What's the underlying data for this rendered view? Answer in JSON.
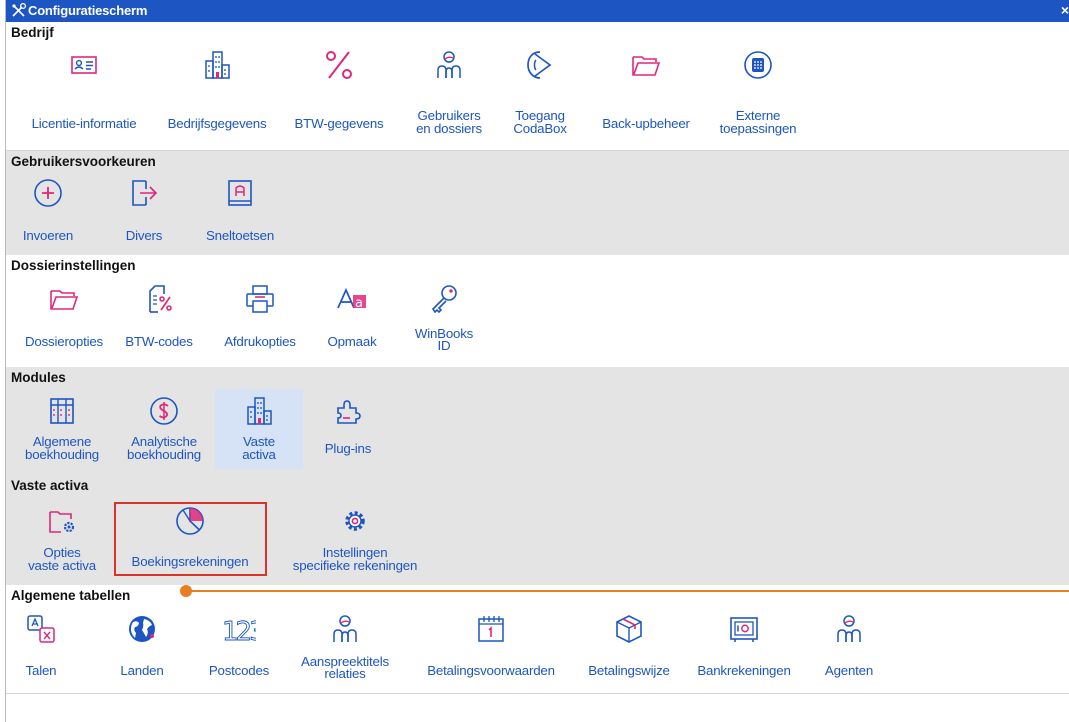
{
  "window": {
    "title": "Configuratiescherm",
    "close": "×"
  },
  "colors": {
    "titlebar": "#1d56c3",
    "link": "#1d56c3",
    "icon_pink": "#e0277a",
    "highlight": "#d9342b",
    "annotation": "#e67e22"
  },
  "sections": {
    "bedrijf": {
      "title": "Bedrijf",
      "items": [
        {
          "label": [
            "Licentie-informatie"
          ],
          "icon": "id-card-icon"
        },
        {
          "label": [
            "Bedrijfsgegevens"
          ],
          "icon": "buildings-icon"
        },
        {
          "label": [
            "BTW-gegevens"
          ],
          "icon": "percent-icon"
        },
        {
          "label": [
            "Gebruikers",
            "en dossiers"
          ],
          "icon": "users-icon"
        },
        {
          "label": [
            "Toegang",
            "CodaBox"
          ],
          "icon": "codabox-icon"
        },
        {
          "label": [
            "Back-upbeheer"
          ],
          "icon": "folder-icon"
        },
        {
          "label": [
            "Externe",
            "toepassingen"
          ],
          "icon": "apps-grid-icon"
        }
      ]
    },
    "gebruikersvoorkeuren": {
      "title": "Gebruikersvoorkeuren",
      "items": [
        {
          "label": [
            "Invoeren"
          ],
          "icon": "plus-circle-icon"
        },
        {
          "label": [
            "Divers"
          ],
          "icon": "export-icon"
        },
        {
          "label": [
            "Sneltoetsen"
          ],
          "icon": "keyboard-key-icon"
        }
      ]
    },
    "dossierinstellingen": {
      "title": "Dossierinstellingen",
      "items": [
        {
          "label": [
            "Dossieropties"
          ],
          "icon": "folder-icon"
        },
        {
          "label": [
            "BTW-codes"
          ],
          "icon": "vat-document-icon"
        },
        {
          "label": [
            "Afdrukopties"
          ],
          "icon": "printer-icon"
        },
        {
          "label": [
            "Opmaak"
          ],
          "icon": "font-icon"
        },
        {
          "label": [
            "WinBooks",
            "ID"
          ],
          "icon": "key-icon"
        }
      ]
    },
    "modules": {
      "title": "Modules",
      "items": [
        {
          "label": [
            "Algemene",
            "boekhouding"
          ],
          "icon": "ledger-icon"
        },
        {
          "label": [
            "Analytische",
            "boekhouding"
          ],
          "icon": "dollar-circle-icon"
        },
        {
          "label": [
            "Vaste",
            "activa"
          ],
          "icon": "buildings-icon",
          "selected": true
        },
        {
          "label": [
            "Plug-ins"
          ],
          "icon": "puzzle-icon"
        }
      ]
    },
    "vaste_activa": {
      "title": "Vaste activa",
      "items": [
        {
          "label": [
            "Opties",
            "vaste activa"
          ],
          "icon": "folder-gear-icon"
        },
        {
          "label": [
            "Boekingsrekeningen"
          ],
          "icon": "pie-chart-icon",
          "highlighted": true
        },
        {
          "label": [
            "Instellingen",
            "specifieke rekeningen"
          ],
          "icon": "gear-icon"
        }
      ]
    },
    "algemene_tabellen": {
      "title": "Algemene tabellen",
      "items": [
        {
          "label": [
            "Talen"
          ],
          "icon": "translate-icon"
        },
        {
          "label": [
            "Landen"
          ],
          "icon": "globe-icon"
        },
        {
          "label": [
            "Postcodes"
          ],
          "icon": "numbers-icon"
        },
        {
          "label": [
            "Aanspreektitels",
            "relaties"
          ],
          "icon": "users-icon"
        },
        {
          "label": [
            "Betalingsvoorwaarden"
          ],
          "icon": "calendar-icon"
        },
        {
          "label": [
            "Betalingswijze"
          ],
          "icon": "box-icon"
        },
        {
          "label": [
            "Bankrekeningen"
          ],
          "icon": "safe-icon"
        },
        {
          "label": [
            "Agenten"
          ],
          "icon": "users-icon"
        }
      ]
    }
  }
}
